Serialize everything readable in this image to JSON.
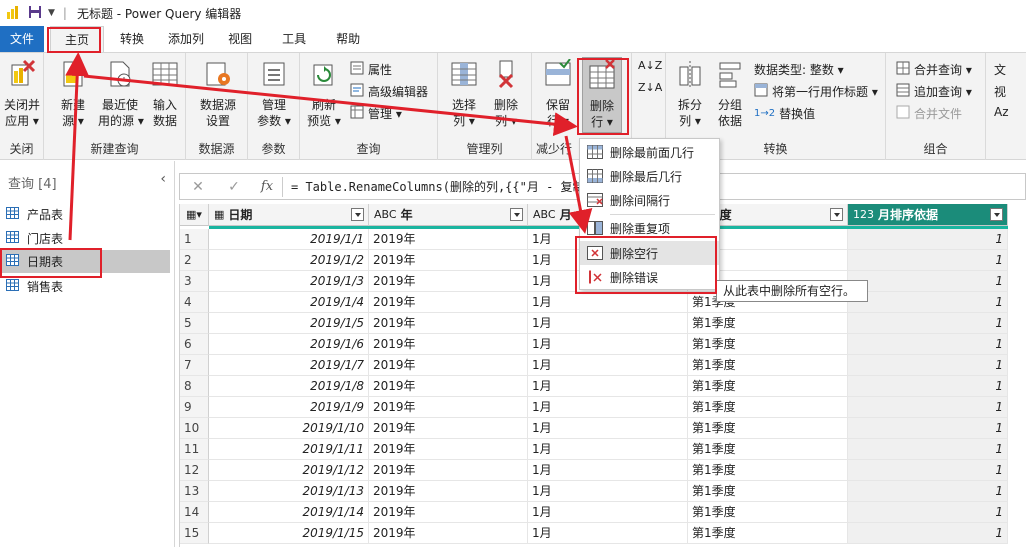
{
  "window": {
    "title": "无标题 - Power Query 编辑器"
  },
  "menu": {
    "tabs": [
      "文件",
      "主页",
      "转换",
      "添加列",
      "视图",
      "工具",
      "帮助"
    ]
  },
  "ribbon": {
    "groups": {
      "close": "关闭",
      "new_query": "新建查询",
      "data_source": "数据源",
      "params": "参数",
      "query": "查询",
      "manage_cols": "管理列",
      "reduce_rows": "减少行",
      "sort": "排序",
      "transform": "转换",
      "combine": "组合"
    },
    "buttons": {
      "close_apply": "关闭并\n应用 ▾",
      "new_source": "新建\n源 ▾",
      "recent_sources": "最近使\n用的源 ▾",
      "enter_data": "输入\n数据",
      "ds_settings": "数据源\n设置",
      "manage_params": "管理\n参数 ▾",
      "refresh_preview": "刷新\n预览 ▾",
      "properties": "属性",
      "advanced_editor": "高级编辑器",
      "manage": "管理 ▾",
      "choose_cols": "选择\n列 ▾",
      "remove_cols": "删除\n列 ▾",
      "keep_rows": "保留\n行 ▾",
      "remove_rows": "删除\n行 ▾",
      "split_col": "拆分\n列 ▾",
      "group_by": "分组\n依据",
      "data_type": "数据类型: 整数 ▾",
      "first_row_header": "将第一行用作标题 ▾",
      "replace_values": "替换值",
      "merge_queries": "合并查询 ▾",
      "append_queries": "追加查询 ▾",
      "combine_files": "合并文件",
      "text_trunc": "文",
      "vision_trunc": "视",
      "az_trunc": "Az"
    }
  },
  "queries": {
    "header": "查询 [4]",
    "items": [
      "产品表",
      "门店表",
      "日期表",
      "销售表"
    ],
    "selected": 2
  },
  "formula": {
    "text": "= Table.RenameColumns(删除的列,{{\"月 - 复制"
  },
  "grid": {
    "columns": [
      {
        "type": "▦",
        "name": "日期"
      },
      {
        "type": "ABC",
        "name": "年"
      },
      {
        "type": "ABC",
        "name": "月"
      },
      {
        "type": "ABC",
        "name": "度"
      },
      {
        "type": "123",
        "name": "月排序依据"
      }
    ],
    "rows": [
      [
        "2019/1/1",
        "2019年",
        "1月",
        "季度",
        "1"
      ],
      [
        "2019/1/2",
        "2019年",
        "1月",
        "季度",
        "1"
      ],
      [
        "2019/1/3",
        "2019年",
        "1月",
        "",
        "1"
      ],
      [
        "2019/1/4",
        "2019年",
        "1月",
        "第1季度",
        "1"
      ],
      [
        "2019/1/5",
        "2019年",
        "1月",
        "第1季度",
        "1"
      ],
      [
        "2019/1/6",
        "2019年",
        "1月",
        "第1季度",
        "1"
      ],
      [
        "2019/1/7",
        "2019年",
        "1月",
        "第1季度",
        "1"
      ],
      [
        "2019/1/8",
        "2019年",
        "1月",
        "第1季度",
        "1"
      ],
      [
        "2019/1/9",
        "2019年",
        "1月",
        "第1季度",
        "1"
      ],
      [
        "2019/1/10",
        "2019年",
        "1月",
        "第1季度",
        "1"
      ],
      [
        "2019/1/11",
        "2019年",
        "1月",
        "第1季度",
        "1"
      ],
      [
        "2019/1/12",
        "2019年",
        "1月",
        "第1季度",
        "1"
      ],
      [
        "2019/1/13",
        "2019年",
        "1月",
        "第1季度",
        "1"
      ],
      [
        "2019/1/14",
        "2019年",
        "1月",
        "第1季度",
        "1"
      ],
      [
        "2019/1/15",
        "2019年",
        "1月",
        "第1季度",
        "1"
      ]
    ]
  },
  "dropdown": {
    "items": [
      "删除最前面几行",
      "删除最后几行",
      "删除间隔行",
      "删除重复项",
      "删除空行",
      "删除错误"
    ],
    "highlighted": 4
  },
  "tooltip": {
    "text": "从此表中删除所有空行。"
  },
  "colors": {
    "accent": "#1f6fc3",
    "teal": "#1b8c7a",
    "highlight": "#e0202a"
  }
}
